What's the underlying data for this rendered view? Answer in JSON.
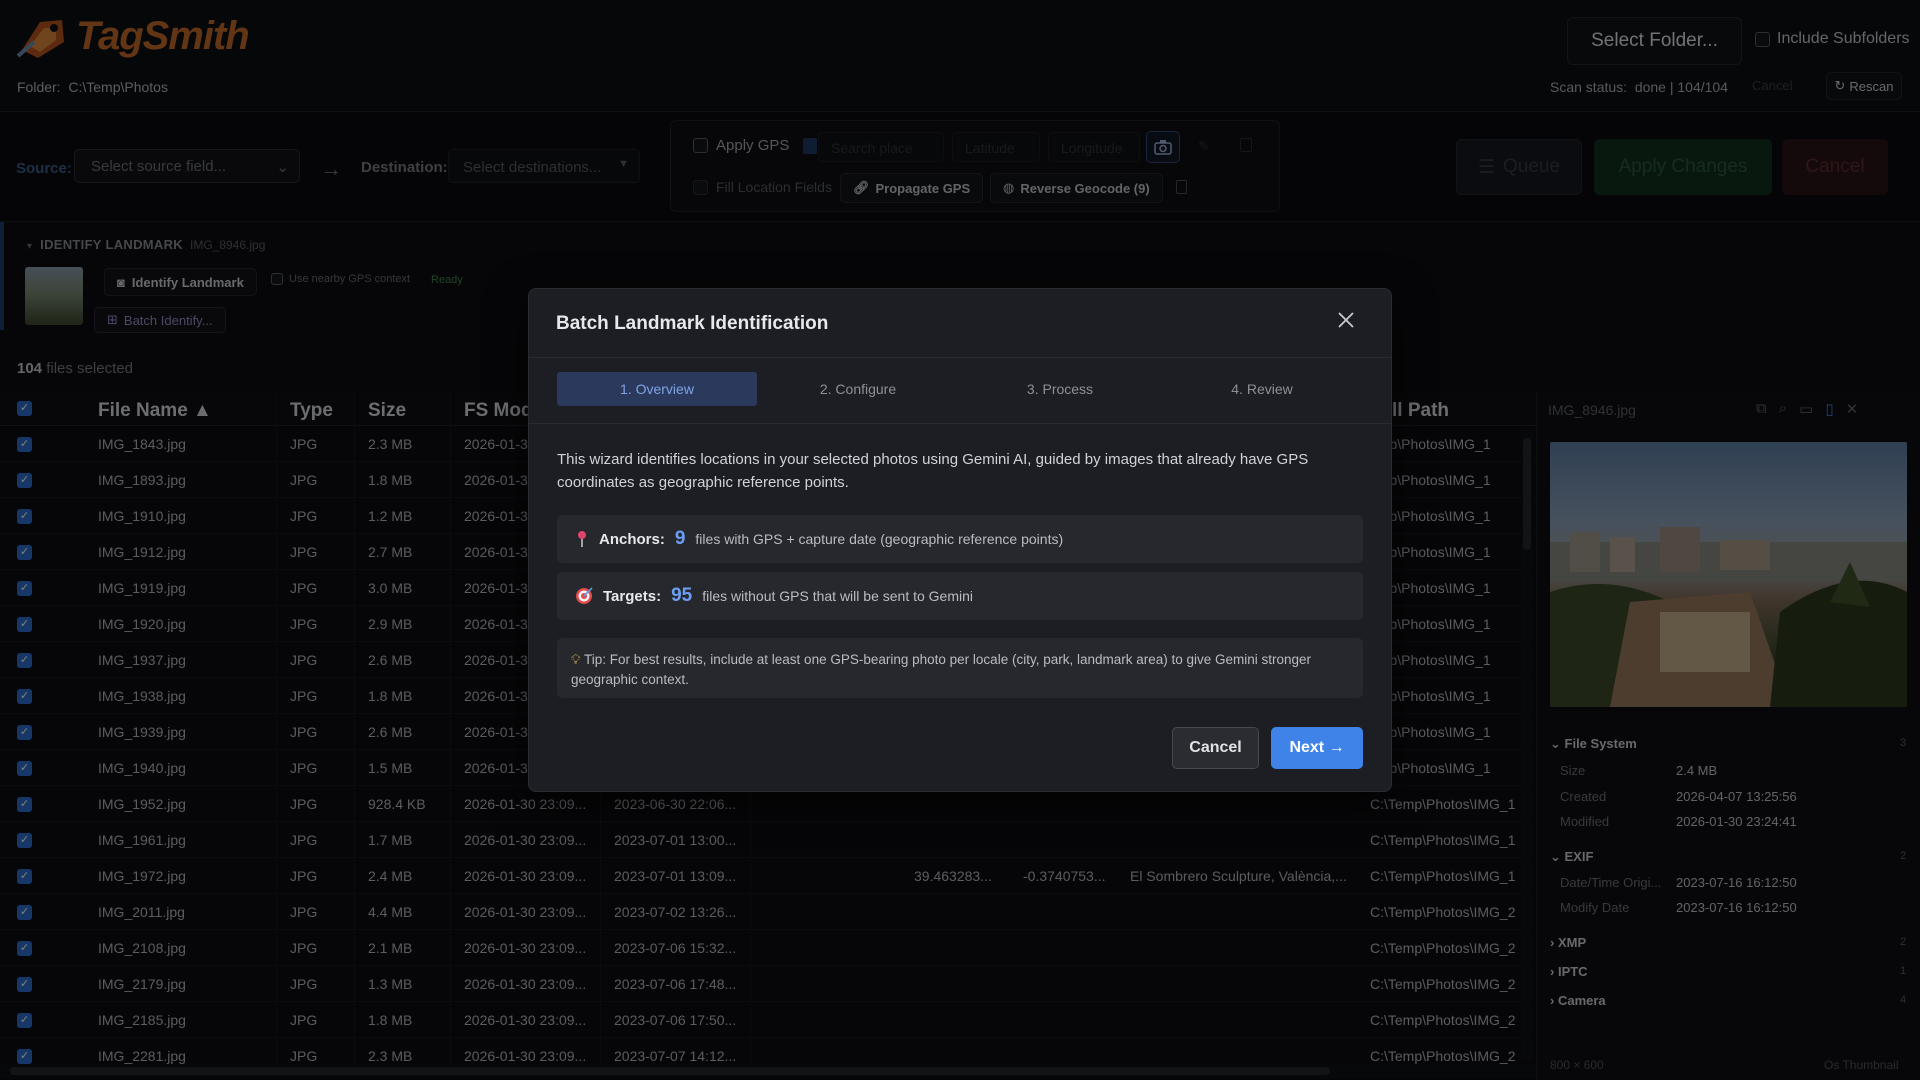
{
  "app": {
    "name": "TagSmith",
    "folder_label": "Folder:",
    "folder_path": "C:\\Temp\\Photos"
  },
  "header": {
    "select_folder": "Select Folder...",
    "include_subfolders": "Include Subfolders",
    "scan_status_label": "Scan status:",
    "scan_status_value": "done | 104/104",
    "cancel": "Cancel",
    "rescan": "Rescan"
  },
  "toolbar": {
    "source_label": "Source:",
    "source_placeholder": "Select source field...",
    "destination_label": "Destination:",
    "destination_placeholder": "Select destinations...",
    "apply_gps": "Apply GPS",
    "search_place": "Search place",
    "latitude": "Latitude",
    "longitude": "Longitude",
    "fill_location": "Fill Location Fields",
    "propagate_gps": "Propagate GPS",
    "reverse_geocode": "Reverse Geocode (9)",
    "queue": "Queue",
    "apply_changes": "Apply Changes",
    "cancel": "Cancel"
  },
  "identify": {
    "title": "IDENTIFY LANDMARK",
    "file": "IMG_8946.jpg",
    "identify_button": "Identify Landmark",
    "nearby_gps": "Use nearby GPS context",
    "status": "Ready",
    "batch_button": "Batch Identify..."
  },
  "selection": {
    "count": "104",
    "label": "files selected"
  },
  "table": {
    "columns": {
      "name": "File Name ▲",
      "type": "Type",
      "size": "Size",
      "fs_mod": "FS Mod",
      "path": "ll Path"
    },
    "rows": [
      {
        "name": "IMG_1843.jpg",
        "type": "JPG",
        "size": "2.3 MB",
        "fsmod": "2026-01-3",
        "date": "",
        "lat": "",
        "lon": "",
        "loc": "",
        "path": "emp\\Photos\\IMG_1"
      },
      {
        "name": "IMG_1893.jpg",
        "type": "JPG",
        "size": "1.8 MB",
        "fsmod": "2026-01-3",
        "date": "",
        "lat": "",
        "lon": "",
        "loc": "",
        "path": "emp\\Photos\\IMG_1"
      },
      {
        "name": "IMG_1910.jpg",
        "type": "JPG",
        "size": "1.2 MB",
        "fsmod": "2026-01-3",
        "date": "",
        "lat": "",
        "lon": "",
        "loc": "",
        "path": "emp\\Photos\\IMG_1"
      },
      {
        "name": "IMG_1912.jpg",
        "type": "JPG",
        "size": "2.7 MB",
        "fsmod": "2026-01-3",
        "date": "",
        "lat": "",
        "lon": "",
        "loc": "",
        "path": "emp\\Photos\\IMG_1"
      },
      {
        "name": "IMG_1919.jpg",
        "type": "JPG",
        "size": "3.0 MB",
        "fsmod": "2026-01-3",
        "date": "",
        "lat": "",
        "lon": "",
        "loc": "",
        "path": "emp\\Photos\\IMG_1"
      },
      {
        "name": "IMG_1920.jpg",
        "type": "JPG",
        "size": "2.9 MB",
        "fsmod": "2026-01-3",
        "date": "",
        "lat": "",
        "lon": "",
        "loc": "",
        "path": "emp\\Photos\\IMG_1"
      },
      {
        "name": "IMG_1937.jpg",
        "type": "JPG",
        "size": "2.6 MB",
        "fsmod": "2026-01-3",
        "date": "",
        "lat": "",
        "lon": "",
        "loc": "",
        "path": "emp\\Photos\\IMG_1"
      },
      {
        "name": "IMG_1938.jpg",
        "type": "JPG",
        "size": "1.8 MB",
        "fsmod": "2026-01-3",
        "date": "",
        "lat": "",
        "lon": "",
        "loc": "",
        "path": "emp\\Photos\\IMG_1"
      },
      {
        "name": "IMG_1939.jpg",
        "type": "JPG",
        "size": "2.6 MB",
        "fsmod": "2026-01-3",
        "date": "",
        "lat": "",
        "lon": "",
        "loc": "",
        "path": "emp\\Photos\\IMG_1"
      },
      {
        "name": "IMG_1940.jpg",
        "type": "JPG",
        "size": "1.5 MB",
        "fsmod": "2026-01-3",
        "date": "",
        "lat": "",
        "lon": "",
        "loc": "",
        "path": "emp\\Photos\\IMG_1"
      },
      {
        "name": "IMG_1952.jpg",
        "type": "JPG",
        "size": "928.4 KB",
        "fsmod": "2026-01-30 23:09...",
        "date": "2023-06-30 22:06...",
        "lat": "",
        "lon": "",
        "loc": "",
        "path": "C:\\Temp\\Photos\\IMG_1"
      },
      {
        "name": "IMG_1961.jpg",
        "type": "JPG",
        "size": "1.7 MB",
        "fsmod": "2026-01-30 23:09...",
        "date": "2023-07-01 13:00...",
        "lat": "",
        "lon": "",
        "loc": "",
        "path": "C:\\Temp\\Photos\\IMG_1"
      },
      {
        "name": "IMG_1972.jpg",
        "type": "JPG",
        "size": "2.4 MB",
        "fsmod": "2026-01-30 23:09...",
        "date": "2023-07-01 13:09...",
        "lat": "39.463283...",
        "lon": "-0.3740753...",
        "loc": "El Sombrero Sculpture, València,...",
        "path": "C:\\Temp\\Photos\\IMG_1"
      },
      {
        "name": "IMG_2011.jpg",
        "type": "JPG",
        "size": "4.4 MB",
        "fsmod": "2026-01-30 23:09...",
        "date": "2023-07-02 13:26...",
        "lat": "",
        "lon": "",
        "loc": "",
        "path": "C:\\Temp\\Photos\\IMG_2"
      },
      {
        "name": "IMG_2108.jpg",
        "type": "JPG",
        "size": "2.1 MB",
        "fsmod": "2026-01-30 23:09...",
        "date": "2023-07-06 15:32...",
        "lat": "",
        "lon": "",
        "loc": "",
        "path": "C:\\Temp\\Photos\\IMG_2"
      },
      {
        "name": "IMG_2179.jpg",
        "type": "JPG",
        "size": "1.3 MB",
        "fsmod": "2026-01-30 23:09...",
        "date": "2023-07-06 17:48...",
        "lat": "",
        "lon": "",
        "loc": "",
        "path": "C:\\Temp\\Photos\\IMG_2"
      },
      {
        "name": "IMG_2185.jpg",
        "type": "JPG",
        "size": "1.8 MB",
        "fsmod": "2026-01-30 23:09...",
        "date": "2023-07-06 17:50...",
        "lat": "",
        "lon": "",
        "loc": "",
        "path": "C:\\Temp\\Photos\\IMG_2"
      },
      {
        "name": "IMG_2281.jpg",
        "type": "JPG",
        "size": "2.3 MB",
        "fsmod": "2026-01-30 23:09...",
        "date": "2023-07-07 14:12...",
        "lat": "",
        "lon": "",
        "loc": "",
        "path": "C:\\Temp\\Photos\\IMG_2"
      }
    ]
  },
  "preview": {
    "file": "IMG_8946.jpg",
    "sections": {
      "file_system": {
        "title": "File System",
        "count": "3"
      },
      "exif": {
        "title": "EXIF",
        "count": "2"
      },
      "xmp": {
        "title": "XMP",
        "count": "2"
      },
      "iptc": {
        "title": "IPTC",
        "count": "1"
      },
      "camera": {
        "title": "Camera",
        "count": "4"
      }
    },
    "fields": {
      "size_k": "Size",
      "size_v": "2.4 MB",
      "created_k": "Created",
      "created_v": "2026-04-07 13:25:56",
      "modified_k": "Modified",
      "modified_v": "2026-01-30 23:24:41",
      "dto_k": "Date/Time Origi...",
      "dto_v": "2023-07-16 16:12:50",
      "md_k": "Modify Date",
      "md_v": "2023-07-16 16:12:50"
    },
    "dimensions": "800 × 600",
    "thumb_label": "Os Thumbnail"
  },
  "modal": {
    "title": "Batch Landmark Identification",
    "steps": [
      "1. Overview",
      "2. Configure",
      "3. Process",
      "4. Review"
    ],
    "description": "This wizard identifies locations in your selected photos using Gemini AI, guided by images that already have GPS coordinates as geographic reference points.",
    "anchors": {
      "label": "Anchors:",
      "count": "9",
      "desc": "files with GPS + capture date (geographic reference points)"
    },
    "targets": {
      "label": "Targets:",
      "count": "95",
      "desc": "files without GPS that will be sent to Gemini"
    },
    "tip": "Tip: For best results, include at least one GPS-bearing photo per locale (city, park, landmark area) to give Gemini stronger geographic context.",
    "cancel": "Cancel",
    "next": "Next →"
  },
  "colors": {
    "accent": "#3f83e8",
    "brand": "#c56a2a",
    "checkbox": "#2f6fd2"
  }
}
